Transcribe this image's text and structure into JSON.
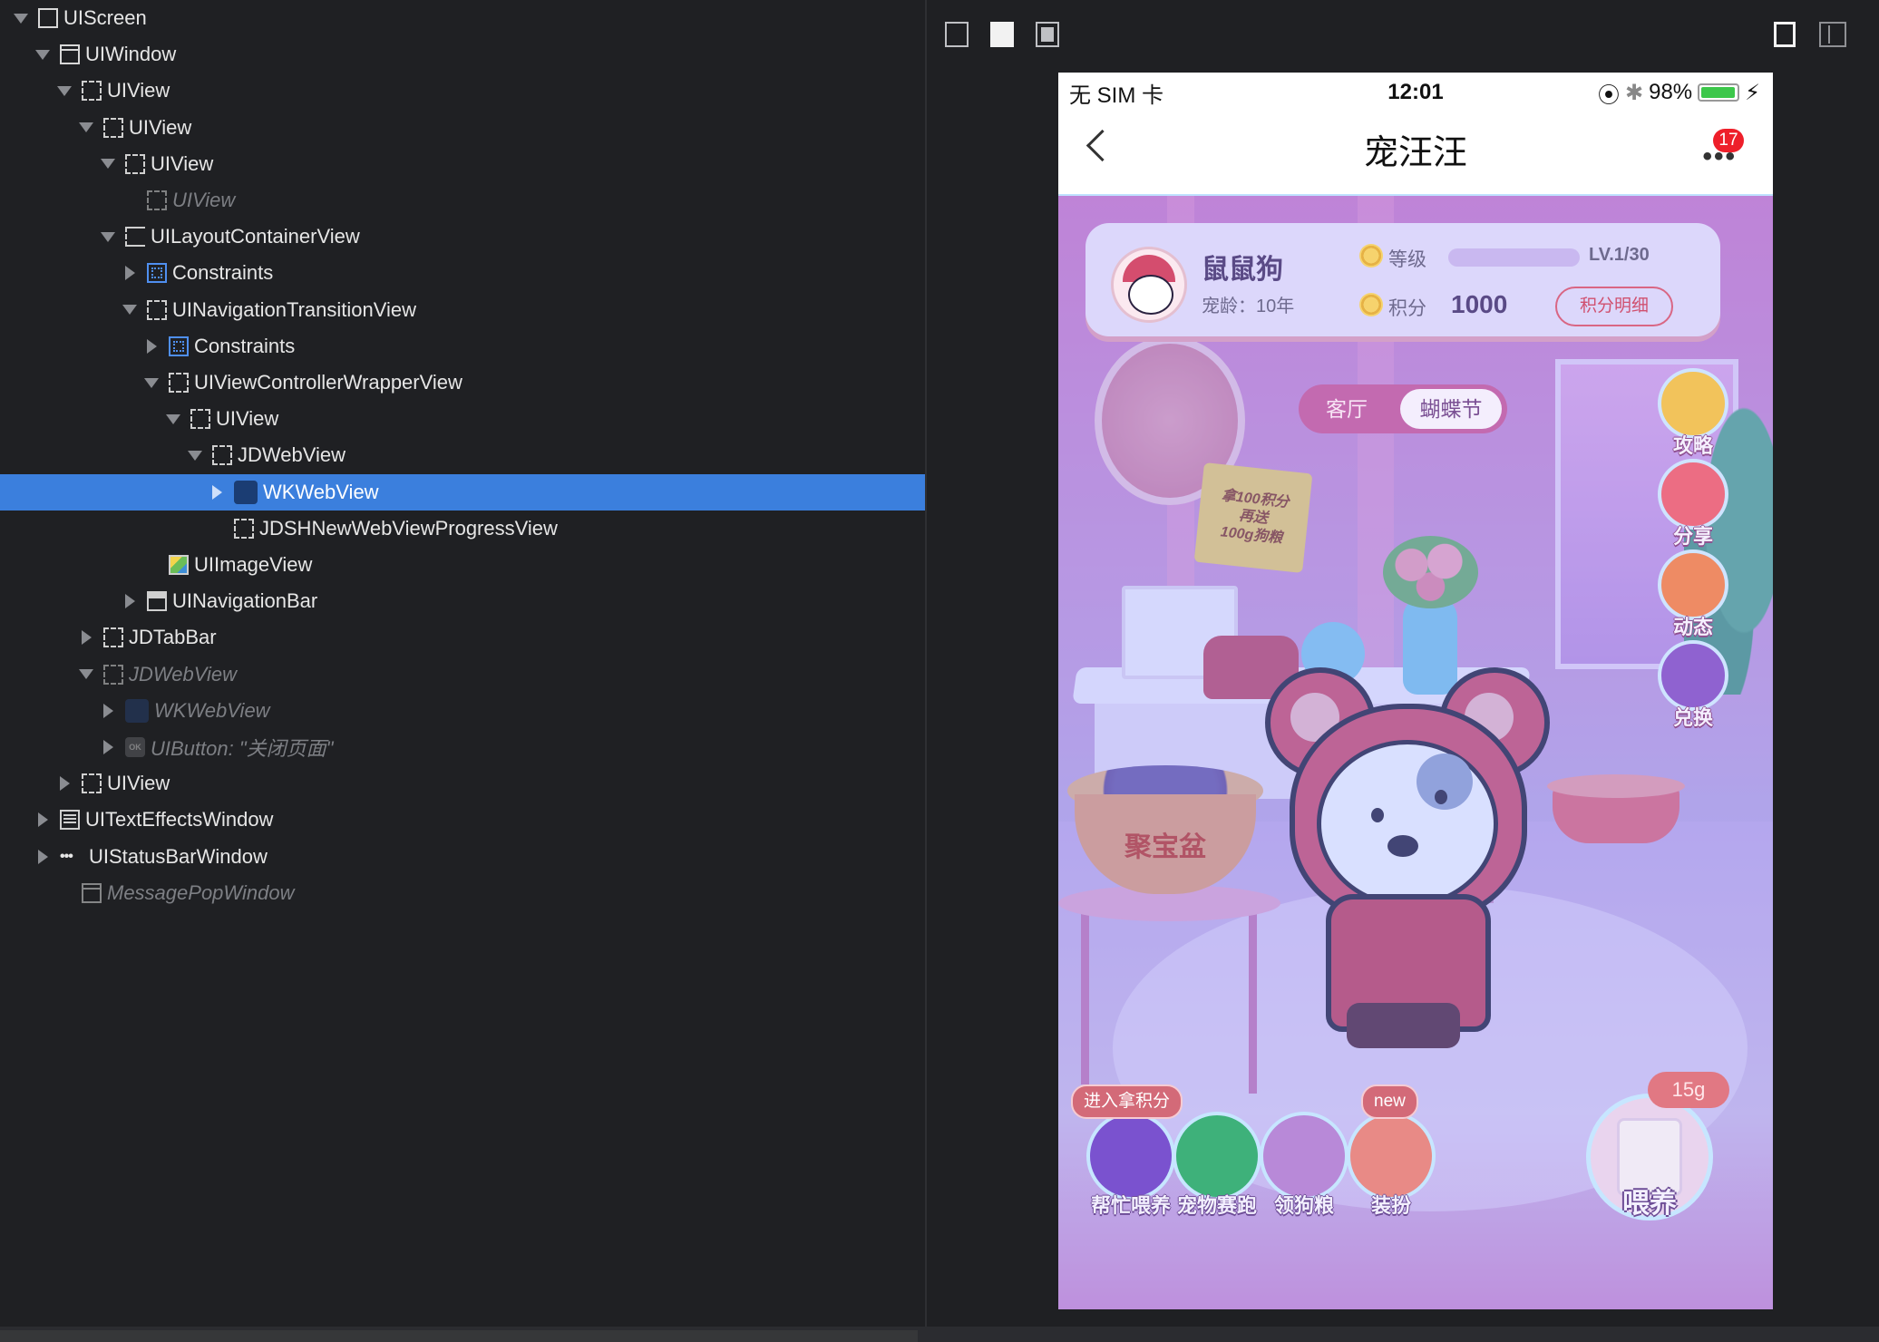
{
  "hierarchy": {
    "nodes": [
      {
        "label": "UIScreen",
        "depth": 0,
        "disclosure": "down",
        "icon": "screen-icon",
        "state": "normal"
      },
      {
        "label": "UIWindow",
        "depth": 1,
        "disclosure": "down",
        "icon": "window-icon",
        "state": "normal"
      },
      {
        "label": "UIView",
        "depth": 2,
        "disclosure": "down",
        "icon": "view-icon",
        "state": "normal"
      },
      {
        "label": "UIView",
        "depth": 3,
        "disclosure": "down",
        "icon": "view-icon",
        "state": "normal"
      },
      {
        "label": "UIView",
        "depth": 4,
        "disclosure": "down",
        "icon": "view-icon",
        "state": "normal"
      },
      {
        "label": "UIView",
        "depth": 5,
        "disclosure": "none",
        "icon": "view-icon",
        "state": "dim"
      },
      {
        "label": "UILayoutContainerView",
        "depth": 4,
        "disclosure": "down",
        "icon": "layout-container-icon",
        "state": "normal"
      },
      {
        "label": "Constraints",
        "depth": 5,
        "disclosure": "right",
        "icon": "constraints-icon",
        "state": "normal"
      },
      {
        "label": "UINavigationTransitionView",
        "depth": 5,
        "disclosure": "down",
        "icon": "view-icon",
        "state": "normal"
      },
      {
        "label": "Constraints",
        "depth": 6,
        "disclosure": "right",
        "icon": "constraints-icon",
        "state": "normal"
      },
      {
        "label": "UIViewControllerWrapperView",
        "depth": 6,
        "disclosure": "down",
        "icon": "view-icon",
        "state": "normal"
      },
      {
        "label": "UIView",
        "depth": 7,
        "disclosure": "down",
        "icon": "view-icon",
        "state": "normal"
      },
      {
        "label": "JDWebView",
        "depth": 8,
        "disclosure": "down",
        "icon": "view-icon",
        "state": "normal"
      },
      {
        "label": "WKWebView",
        "depth": 9,
        "disclosure": "right",
        "icon": "compass-icon",
        "state": "selected"
      },
      {
        "label": "JDSHNewWebViewProgressView",
        "depth": 9,
        "disclosure": "none",
        "icon": "view-icon",
        "state": "normal"
      },
      {
        "label": "UIImageView",
        "depth": 6,
        "disclosure": "none",
        "icon": "image-view-icon",
        "state": "normal"
      },
      {
        "label": "UINavigationBar",
        "depth": 5,
        "disclosure": "right",
        "icon": "navigation-bar-icon",
        "state": "normal"
      },
      {
        "label": "JDTabBar",
        "depth": 3,
        "disclosure": "right",
        "icon": "view-icon",
        "state": "normal"
      },
      {
        "label": "JDWebView",
        "depth": 3,
        "disclosure": "down",
        "icon": "view-icon",
        "state": "dim"
      },
      {
        "label": "WKWebView",
        "depth": 4,
        "disclosure": "right",
        "icon": "compass-icon",
        "state": "dim"
      },
      {
        "label": "UIButton: \"关闭页面\"",
        "depth": 4,
        "disclosure": "right",
        "icon": "button-icon",
        "state": "dim"
      },
      {
        "label": "UIView",
        "depth": 2,
        "disclosure": "right",
        "icon": "view-icon",
        "state": "normal"
      },
      {
        "label": "UITextEffectsWindow",
        "depth": 1,
        "disclosure": "right",
        "icon": "text-window-icon",
        "state": "normal"
      },
      {
        "label": "UIStatusBarWindow",
        "depth": 1,
        "disclosure": "right",
        "icon": "dots-icon",
        "state": "normal"
      },
      {
        "label": "MessagePopWindow",
        "depth": 2,
        "disclosure": "none",
        "icon": "window-icon",
        "state": "dim"
      }
    ],
    "button_icon_text": "OK"
  },
  "phone": {
    "status": {
      "carrier": "无 SIM 卡",
      "time": "12:01",
      "battery": "98%"
    },
    "nav": {
      "title": "宠汪汪",
      "badge": "17",
      "more": "•••"
    },
    "card": {
      "pet_name": "鼠鼠狗",
      "pet_age": "宠龄：10年",
      "level_label": "等级",
      "level_value": "LV.1/30",
      "points_label": "积分",
      "points_value": "1000",
      "detail_button": "积分明细"
    },
    "room_tabs": [
      "客厅",
      "蝴蝶节"
    ],
    "tag_lines": [
      "拿100积分",
      "再送",
      "100g狗粮"
    ],
    "treasure_bowl": "聚宝盆",
    "side_actions": [
      {
        "label": "攻略",
        "icon": "guide-icon",
        "color": "#f2c35b"
      },
      {
        "label": "分享",
        "icon": "paper-plane-icon",
        "color": "#ec6d83"
      },
      {
        "label": "动态",
        "icon": "chat-bubble-icon",
        "color": "#ee8b64"
      },
      {
        "label": "兑换",
        "icon": "gift-icon",
        "color": "#8f62d0"
      }
    ],
    "bottom_actions": [
      {
        "label": "帮忙喂养",
        "icon": "food-bowl-icon",
        "color": "#7a52cf",
        "pill": "进入拿积分"
      },
      {
        "label": "宠物赛跑",
        "icon": "trophy-icon",
        "color": "#3eb17a",
        "pill": ""
      },
      {
        "label": "领狗粮",
        "icon": "dog-food-icon",
        "color": "#b889d8",
        "pill": ""
      },
      {
        "label": "装扮",
        "icon": "shirt-icon",
        "color": "#e88a86",
        "pill": "new"
      }
    ],
    "feed": {
      "label": "喂养",
      "amount": "15g"
    }
  },
  "colors": {
    "selected_row": "#3b7fdd",
    "badge_red": "#ee1f2a",
    "card_bg": "#dcd7fb"
  }
}
